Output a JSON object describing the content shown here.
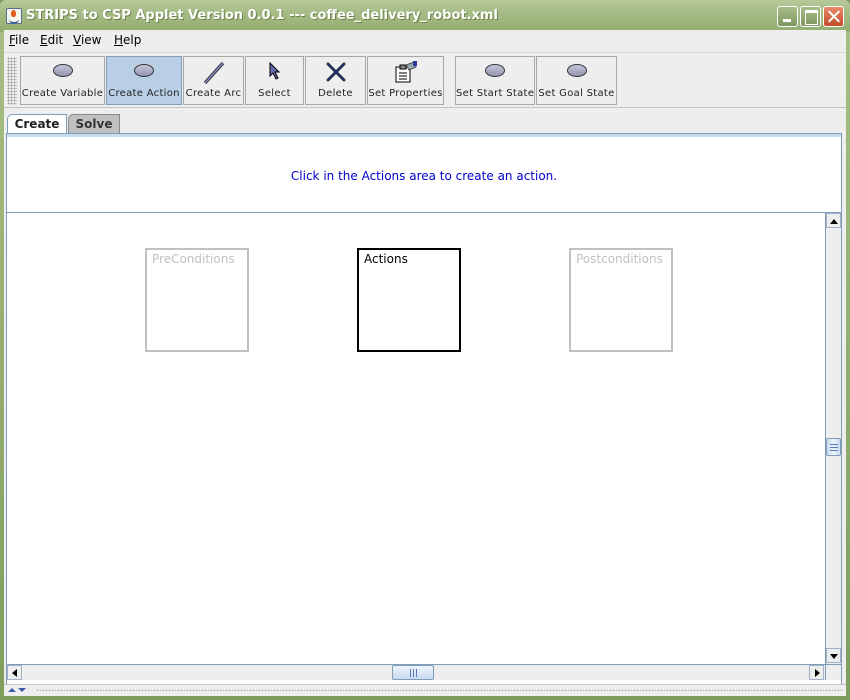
{
  "window": {
    "title": "STRIPS to CSP Applet Version 0.0.1 --- coffee_delivery_robot.xml",
    "controls": [
      "minimize",
      "maximize",
      "close"
    ]
  },
  "menu": [
    {
      "label": "File",
      "mnemonic": "F",
      "rest": "ile"
    },
    {
      "label": "Edit",
      "mnemonic": "E",
      "rest": "dit"
    },
    {
      "label": "View",
      "mnemonic": "V",
      "rest": "iew"
    },
    {
      "label": "Help",
      "mnemonic": "H",
      "rest": "elp"
    }
  ],
  "toolbar": {
    "buttons": [
      {
        "label": "Create Variable",
        "icon": "oval-node-icon",
        "active": false
      },
      {
        "label": "Create Action",
        "icon": "oval-node-icon",
        "active": true
      },
      {
        "label": "Create Arc",
        "icon": "line-arc-icon",
        "active": false
      },
      {
        "label": "Select",
        "icon": "pointer-arrow-icon",
        "active": false
      },
      {
        "label": "Delete",
        "icon": "x-delete-icon",
        "active": false
      },
      {
        "label": "Set Properties",
        "icon": "properties-clipboard-icon",
        "active": false
      },
      {
        "label": "Set Start State",
        "icon": "oval-node-icon",
        "active": false
      },
      {
        "label": "Set Goal State",
        "icon": "oval-node-icon",
        "active": false
      }
    ]
  },
  "tabs": [
    {
      "label": "Create",
      "selected": true
    },
    {
      "label": "Solve",
      "selected": false
    }
  ],
  "message": "Click in the Actions area to create an action.",
  "canvas": {
    "areas": [
      {
        "label": "PreConditions",
        "active": false
      },
      {
        "label": "Actions",
        "active": true
      },
      {
        "label": "Postconditions",
        "active": false
      }
    ]
  },
  "colors": {
    "message_text": "#0000cc",
    "active_button_bg": "#b8cfe5",
    "titlebar": "#a5bb84",
    "inactive_area_border": "#c0c0c0",
    "active_area_border": "#000000"
  }
}
